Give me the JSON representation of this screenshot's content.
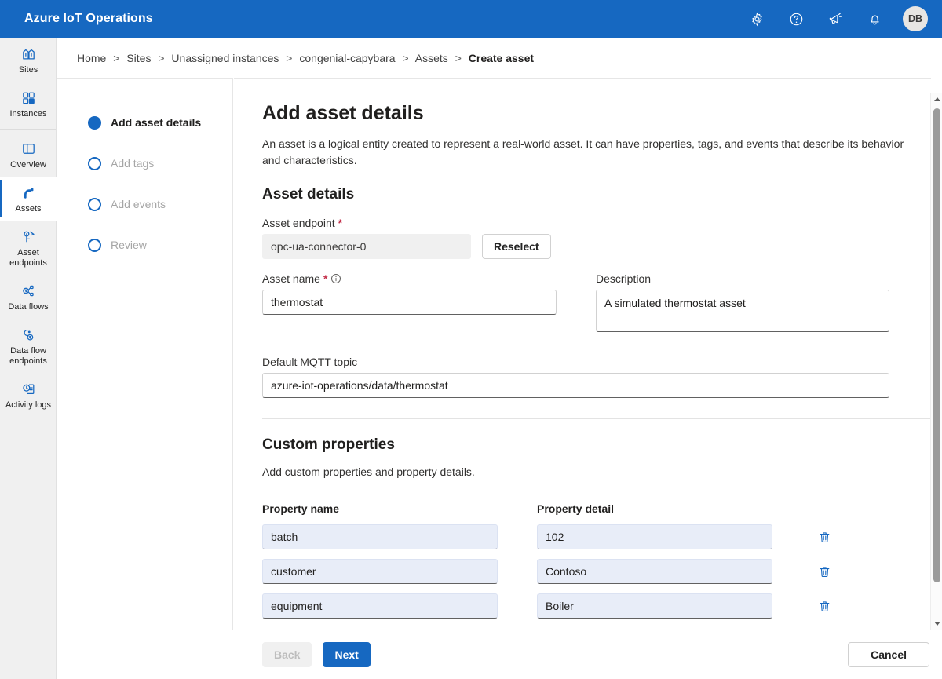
{
  "header": {
    "title": "Azure IoT Operations",
    "icons": [
      {
        "name": "gear-icon",
        "label": "Settings"
      },
      {
        "name": "help-icon",
        "label": "Help"
      },
      {
        "name": "feedback-icon",
        "label": "Feedback"
      },
      {
        "name": "bell-icon",
        "label": "Notifications"
      }
    ],
    "avatar_initials": "DB",
    "background_color": "#1668c1"
  },
  "rail": {
    "items": [
      {
        "label": "Sites",
        "icon": "sites-icon",
        "selected": false
      },
      {
        "label": "Instances",
        "icon": "instances-icon",
        "selected": false
      },
      {
        "label": "Overview",
        "icon": "overview-icon",
        "selected": false
      },
      {
        "label": "Assets",
        "icon": "assets-icon",
        "selected": true
      },
      {
        "label": "Asset\nendpoints",
        "icon": "asset-endpoints-icon",
        "selected": false
      },
      {
        "label": "Data flows",
        "icon": "data-flows-icon",
        "selected": false
      },
      {
        "label": "Data flow\nendpoints",
        "icon": "data-flow-endpoints-icon",
        "selected": false
      },
      {
        "label": "Activity\nlogs",
        "icon": "activity-logs-icon",
        "selected": false
      }
    ]
  },
  "breadcrumb": {
    "items": [
      "Home",
      "Sites",
      "Unassigned instances",
      "congenial-capybara",
      "Assets"
    ],
    "current": "Create asset",
    "separator": ">"
  },
  "wizard": {
    "steps": [
      {
        "label": "Add asset details",
        "active": true
      },
      {
        "label": "Add tags",
        "active": false
      },
      {
        "label": "Add events",
        "active": false
      },
      {
        "label": "Review",
        "active": false
      }
    ]
  },
  "form": {
    "page_title": "Add asset details",
    "page_description": "An asset is a logical entity created to represent a real-world asset. It can have properties, tags, and events that describe its behavior and characteristics.",
    "asset_details_title": "Asset details",
    "asset_endpoint": {
      "label": "Asset endpoint",
      "required_marker": "*",
      "value": "opc-ua-connector-0",
      "reselect_label": "Reselect"
    },
    "asset_name": {
      "label": "Asset name",
      "required_marker": "*",
      "value": "thermostat",
      "placeholder": ""
    },
    "description": {
      "label": "Description",
      "value": "A simulated thermostat asset",
      "placeholder": ""
    },
    "mqtt_topic": {
      "label": "Default MQTT topic",
      "value": "azure-iot-operations/data/thermostat",
      "placeholder": ""
    }
  },
  "custom_properties": {
    "title": "Custom properties",
    "description": "Add custom properties and property details.",
    "col_name_header": "Property name",
    "col_detail_header": "Property detail",
    "rows": [
      {
        "name": "batch",
        "detail": "102"
      },
      {
        "name": "customer",
        "detail": "Contoso"
      },
      {
        "name": "equipment",
        "detail": "Boiler"
      }
    ],
    "delete_icon": "trash-icon"
  },
  "footer": {
    "back_label": "Back",
    "back_disabled": true,
    "next_label": "Next",
    "cancel_label": "Cancel"
  },
  "colors": {
    "brand_blue": "#1668c1",
    "required_red": "#c4314b",
    "filled_input": "#e8edf8"
  }
}
